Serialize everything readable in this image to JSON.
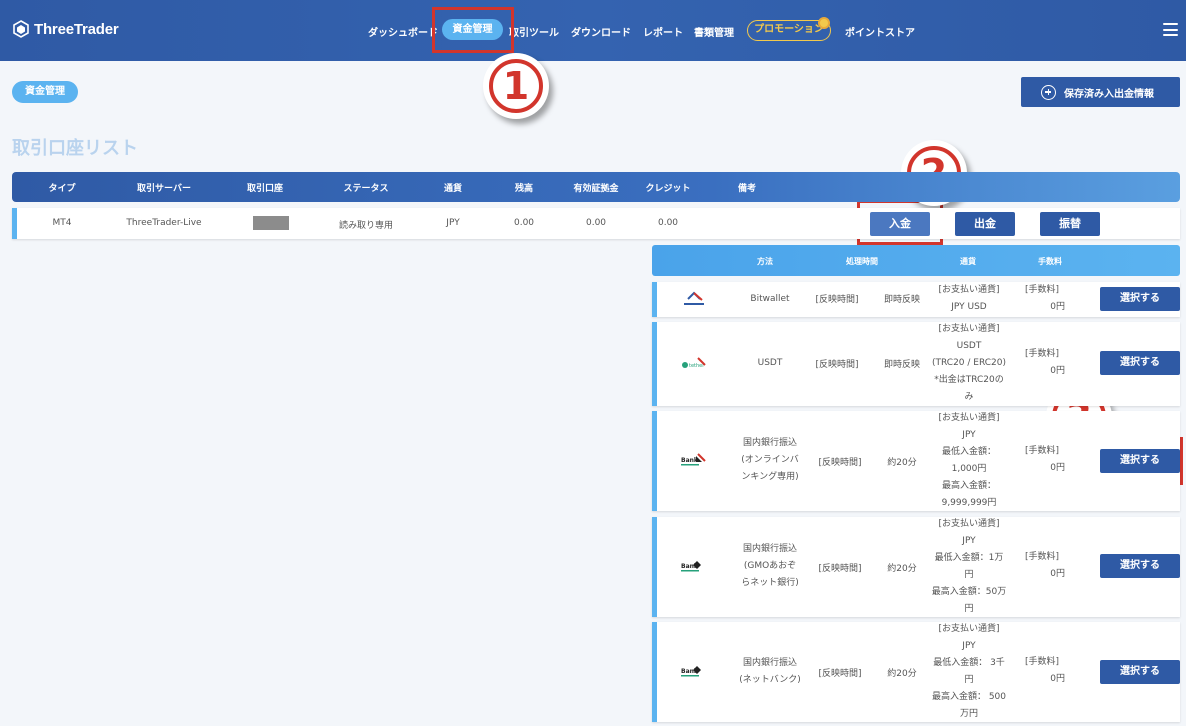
{
  "header": {
    "logo_text": "ThreeTrader",
    "nav": [
      {
        "label": "ダッシュボード"
      },
      {
        "label": "資金管理"
      },
      {
        "label": "取引ツール"
      },
      {
        "label": "ダウンロード"
      },
      {
        "label": "レポート"
      },
      {
        "label": "書類管理"
      },
      {
        "label": "プロモーション"
      },
      {
        "label": "ポイントストア"
      }
    ]
  },
  "page": {
    "tag": "資金管理",
    "save_button": "保存済み入出金情報",
    "section_title": "取引口座リスト"
  },
  "account_table": {
    "headers": [
      "タイプ",
      "取引サーバー",
      "取引口座",
      "ステータス",
      "通貨",
      "残高",
      "有効証拠金",
      "クレジット",
      "備考"
    ],
    "row": {
      "type": "MT4",
      "server": "ThreeTrader-Live",
      "status": "読み取り専用",
      "currency": "JPY",
      "balance": "0.00",
      "equity": "0.00",
      "credit": "0.00"
    },
    "actions": {
      "deposit": "入金",
      "withdraw": "出金",
      "transfer": "振替"
    }
  },
  "payment_table": {
    "headers": [
      "方法",
      "処理時間",
      "通貨",
      "手数料"
    ],
    "select_label": "選択する",
    "rows": [
      {
        "logo": "bitwallet-logo",
        "name": "Bitwallet",
        "time_label": "[反映時間]",
        "time_value": "即時反映",
        "currency_lines": [
          "[お支払い通貨]",
          "JPY USD"
        ],
        "fee_lines": [
          "[手数料]",
          "0円"
        ]
      },
      {
        "logo": "tether-logo",
        "name": "USDT",
        "time_label": "[反映時間]",
        "time_value": "即時反映",
        "currency_lines": [
          "[お支払い通貨]",
          "USDT",
          "(TRC20 / ERC20)",
          "*出金はTRC20の",
          "み"
        ],
        "fee_lines": [
          "[手数料]",
          "0円"
        ]
      },
      {
        "logo": "bank-transfer-logo",
        "name_lines": [
          "国内銀行振込",
          "(オンラインバ",
          "ンキング専用)"
        ],
        "time_label": "[反映時間]",
        "time_value": "約20分",
        "currency_lines": [
          "[お支払い通貨]",
          "JPY",
          "最低入金額：",
          "1,000円",
          "最高入金額：",
          "9,999,999円"
        ],
        "fee_lines": [
          "[手数料]",
          "0円"
        ]
      },
      {
        "logo": "bank-transfer-logo",
        "name_lines": [
          "国内銀行振込",
          "(GMOあおぞ",
          "らネット銀行)"
        ],
        "time_label": "[反映時間]",
        "time_value": "約20分",
        "currency_lines": [
          "[お支払い通貨]",
          "JPY",
          "最低入金額：1万",
          "円",
          "最高入金額：50万",
          "円"
        ],
        "fee_lines": [
          "[手数料]",
          "0円"
        ]
      },
      {
        "logo": "bank-transfer-logo",
        "name_lines": [
          "国内銀行振込",
          "(ネットバンク)"
        ],
        "time_label": "[反映時間]",
        "time_value": "約20分",
        "currency_lines": [
          "[お支払い通貨]",
          "JPY",
          "最低入金額： 3千",
          "円",
          "最高入金額： 500",
          "万円"
        ],
        "fee_lines": [
          "[手数料]",
          "0円"
        ]
      }
    ]
  },
  "annotations": {
    "step1": "1",
    "step2": "2",
    "step3": "3",
    "accent_color": "#d2352c"
  },
  "colors": {
    "header_blue": "#2f5aa5",
    "accent_light_blue": "#5bb3f0",
    "promo_gold": "#f2c94c"
  }
}
